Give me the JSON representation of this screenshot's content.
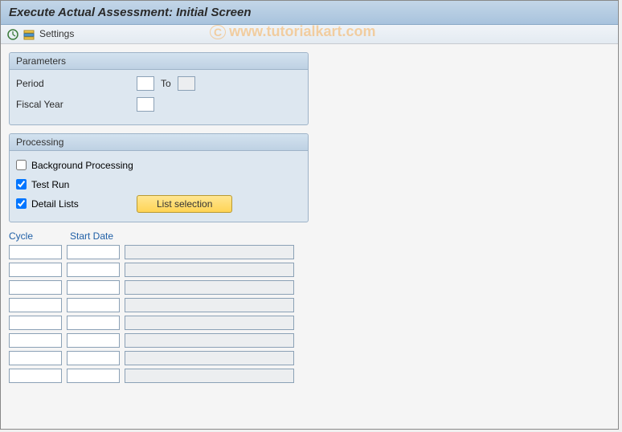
{
  "header": {
    "title": "Execute Actual Assessment: Initial Screen"
  },
  "toolbar": {
    "settings_label": "Settings"
  },
  "watermark": "www.tutorialkart.com",
  "parameters": {
    "title": "Parameters",
    "period_label": "Period",
    "period_value": "",
    "to_label": "To",
    "to_value": "",
    "fiscal_year_label": "Fiscal Year",
    "fiscal_year_value": ""
  },
  "processing": {
    "title": "Processing",
    "background_label": "Background Processing",
    "background_checked": false,
    "testrun_label": "Test Run",
    "testrun_checked": true,
    "detail_label": "Detail Lists",
    "detail_checked": true,
    "list_selection_label": "List selection"
  },
  "table": {
    "cycle_header": "Cycle",
    "startdate_header": "Start Date",
    "rows": [
      {
        "cycle": "",
        "start_date": "",
        "desc": ""
      },
      {
        "cycle": "",
        "start_date": "",
        "desc": ""
      },
      {
        "cycle": "",
        "start_date": "",
        "desc": ""
      },
      {
        "cycle": "",
        "start_date": "",
        "desc": ""
      },
      {
        "cycle": "",
        "start_date": "",
        "desc": ""
      },
      {
        "cycle": "",
        "start_date": "",
        "desc": ""
      },
      {
        "cycle": "",
        "start_date": "",
        "desc": ""
      },
      {
        "cycle": "",
        "start_date": "",
        "desc": ""
      }
    ]
  }
}
